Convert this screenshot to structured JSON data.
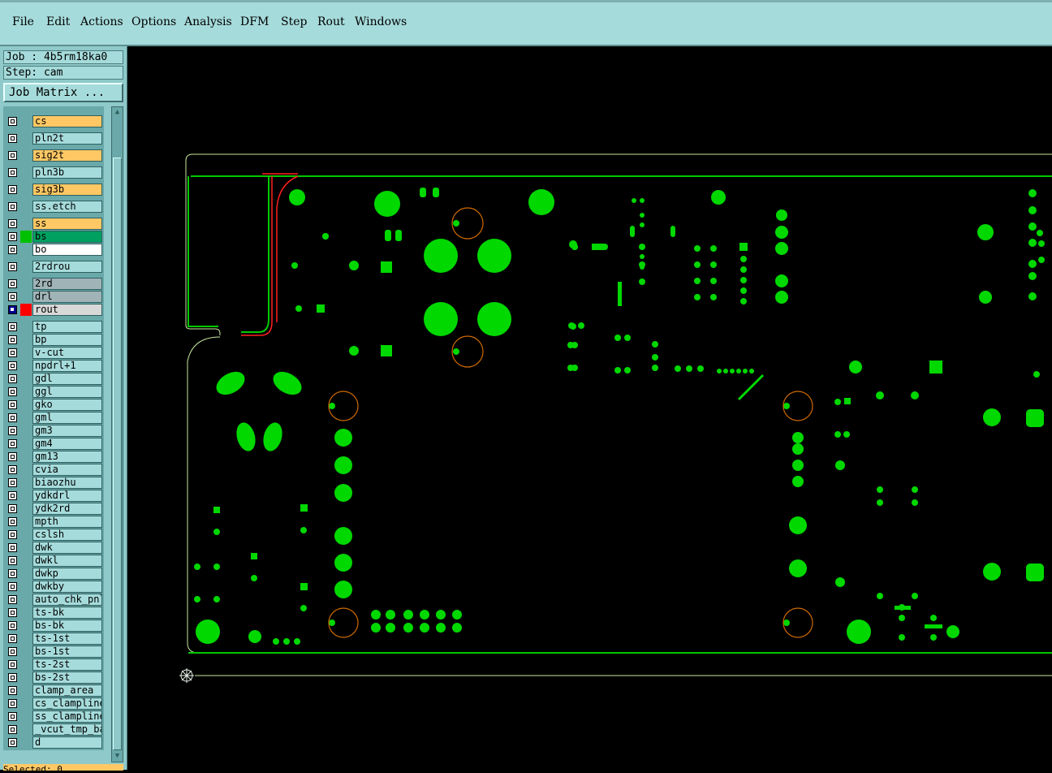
{
  "menubar": {
    "items": [
      "File",
      "Edit",
      "Actions",
      "Options",
      "Analysis",
      "DFM",
      "Step",
      "Rout",
      "Windows"
    ]
  },
  "job": {
    "label": "Job : 4b5rm18ka0"
  },
  "step": {
    "label": "Step: cam"
  },
  "job_matrix_button": "Job Matrix ...",
  "layers": [
    {
      "name": "cs",
      "color": "#ffc864"
    },
    {
      "name": "pln2t",
      "color": "#a6dbdb"
    },
    {
      "name": "sig2t",
      "color": "#ffc864"
    },
    {
      "name": "pln3b",
      "color": "#a6dbdb"
    },
    {
      "name": "sig3b",
      "color": "#ffc864"
    },
    {
      "name": "ss.etch",
      "color": "#a6dbdb"
    },
    {
      "name": "ss",
      "color": "#ffc864"
    },
    {
      "name": "bs",
      "color": "#00a060"
    },
    {
      "name": "bo",
      "color": "#ffffff"
    },
    {
      "name": "2rdrou",
      "color": "#a6dbdb"
    },
    {
      "name": "2rd",
      "color": "#a0b4b8"
    },
    {
      "name": "drl",
      "color": "#a0b4b8"
    },
    {
      "name": "rout",
      "color": "#d8d8d8"
    },
    {
      "name": "tp",
      "color": "#a6dbdb"
    },
    {
      "name": "bp",
      "color": "#a6dbdb"
    },
    {
      "name": "v-cut",
      "color": "#a6dbdb"
    },
    {
      "name": "npdrl+1",
      "color": "#a6dbdb"
    },
    {
      "name": "gdl",
      "color": "#a6dbdb"
    },
    {
      "name": "ggl",
      "color": "#a6dbdb"
    },
    {
      "name": "gko",
      "color": "#a6dbdb"
    },
    {
      "name": "gml",
      "color": "#a6dbdb"
    },
    {
      "name": "gm3",
      "color": "#a6dbdb"
    },
    {
      "name": "gm4",
      "color": "#a6dbdb"
    },
    {
      "name": "gm13",
      "color": "#a6dbdb"
    },
    {
      "name": "cvia",
      "color": "#a6dbdb"
    },
    {
      "name": "biaozhu",
      "color": "#a6dbdb"
    },
    {
      "name": "ydkdrl",
      "color": "#a6dbdb"
    },
    {
      "name": "ydk2rd",
      "color": "#a6dbdb"
    },
    {
      "name": "mpth",
      "color": "#a6dbdb"
    },
    {
      "name": "cslsh",
      "color": "#a6dbdb"
    },
    {
      "name": "dwk",
      "color": "#a6dbdb"
    },
    {
      "name": "dwkl",
      "color": "#a6dbdb"
    },
    {
      "name": "dwkp",
      "color": "#a6dbdb"
    },
    {
      "name": "dwkby",
      "color": "#a6dbdb"
    },
    {
      "name": "auto_chk_pnl",
      "color": "#a6dbdb"
    },
    {
      "name": "ts-bk",
      "color": "#a6dbdb"
    },
    {
      "name": "bs-bk",
      "color": "#a6dbdb"
    },
    {
      "name": "ts-1st",
      "color": "#a6dbdb"
    },
    {
      "name": "bs-1st",
      "color": "#a6dbdb"
    },
    {
      "name": "ts-2st",
      "color": "#a6dbdb"
    },
    {
      "name": "bs-2st",
      "color": "#a6dbdb"
    },
    {
      "name": "clamp_area",
      "color": "#a6dbdb"
    },
    {
      "name": "cs_clampline",
      "color": "#a6dbdb"
    },
    {
      "name": "ss_clampline",
      "color": "#a6dbdb"
    },
    {
      "name": "_vcut_tmp_ba",
      "color": "#a6dbdb"
    },
    {
      "name": "d",
      "color": "#a6dbdb"
    }
  ],
  "colors": {
    "pad_green": "#00d800",
    "outline_green": "#00c800",
    "drill_ring": "#d04000",
    "rout_red": "#ff2020",
    "rout_active_swatch": "#ff0000",
    "bs_swatch": "#00c000"
  },
  "status_bottom": "Selected: 0"
}
